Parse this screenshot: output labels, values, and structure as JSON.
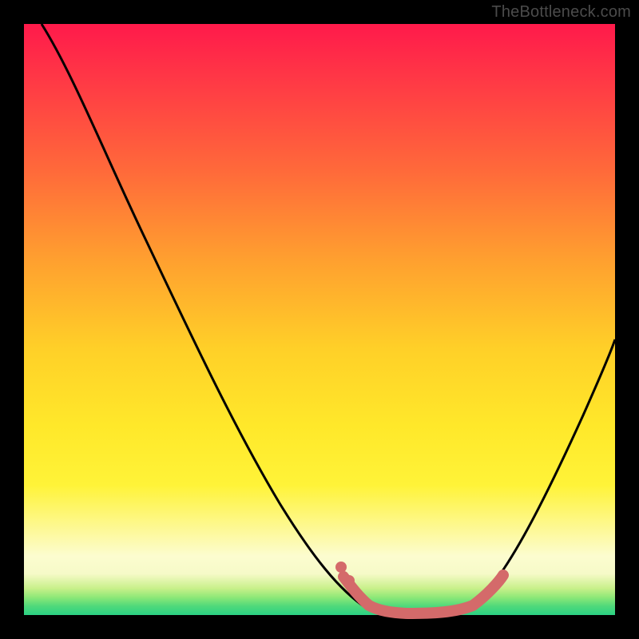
{
  "watermark": "TheBottleneck.com",
  "chart_data": {
    "type": "line",
    "title": "",
    "xlabel": "",
    "ylabel": "",
    "xlim": [
      0,
      100
    ],
    "ylim": [
      0,
      100
    ],
    "series": [
      {
        "name": "bottleneck-curve",
        "x": [
          3,
          10,
          20,
          30,
          40,
          48,
          54,
          58,
          62,
          68,
          74,
          80,
          86,
          92,
          100
        ],
        "values": [
          100,
          88,
          72,
          56,
          40,
          24,
          12,
          5,
          1,
          0,
          0,
          3,
          12,
          26,
          48
        ]
      }
    ],
    "annotations": {
      "highlight_segment": {
        "name": "optimal-range",
        "color": "#d46a6a",
        "x": [
          54,
          58,
          62,
          68,
          74,
          80
        ],
        "values": [
          12,
          5,
          1,
          0,
          0,
          3
        ]
      }
    },
    "gradient_stops": [
      {
        "pos": 0,
        "color": "#ff1a4b"
      },
      {
        "pos": 0.1,
        "color": "#ff3a45"
      },
      {
        "pos": 0.25,
        "color": "#ff6a3a"
      },
      {
        "pos": 0.4,
        "color": "#ffa02f"
      },
      {
        "pos": 0.55,
        "color": "#ffd028"
      },
      {
        "pos": 0.68,
        "color": "#ffe82a"
      },
      {
        "pos": 0.78,
        "color": "#fff338"
      },
      {
        "pos": 0.9,
        "color": "#fcfccf"
      },
      {
        "pos": 0.93,
        "color": "#f6fac8"
      },
      {
        "pos": 0.955,
        "color": "#c8f08a"
      },
      {
        "pos": 0.97,
        "color": "#8ee878"
      },
      {
        "pos": 0.985,
        "color": "#4fd97a"
      },
      {
        "pos": 1.0,
        "color": "#2bd184"
      }
    ]
  }
}
